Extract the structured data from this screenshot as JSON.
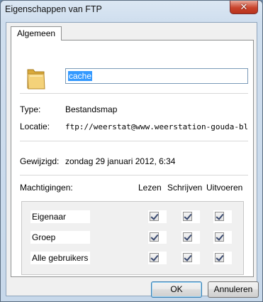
{
  "window": {
    "title": "Eigenschappen van FTP",
    "close_symbol": "✕"
  },
  "tabs": [
    {
      "label": "Algemeen"
    }
  ],
  "general": {
    "name_value": "cache",
    "type_label": "Type:",
    "type_value": "Bestandsmap",
    "location_label": "Locatie:",
    "location_value": "ftp://weerstat@www.weerstation-gouda-bloemendaal.",
    "modified_label": "Gewijzigd:",
    "modified_value": "zondag 29 januari 2012, 6:34"
  },
  "permissions": {
    "label": "Machtigingen:",
    "columns": [
      "Lezen",
      "Schrijven",
      "Uitvoeren"
    ],
    "rows": [
      {
        "name": "Eigenaar",
        "checked": [
          true,
          true,
          true
        ]
      },
      {
        "name": "Groep",
        "checked": [
          true,
          true,
          true
        ]
      },
      {
        "name": "Alle gebruikers",
        "checked": [
          true,
          true,
          true
        ]
      }
    ]
  },
  "buttons": {
    "ok": "OK",
    "cancel": "Annuleren"
  },
  "colors": {
    "selection": "#3399ff",
    "close_button": "#c9442c"
  }
}
